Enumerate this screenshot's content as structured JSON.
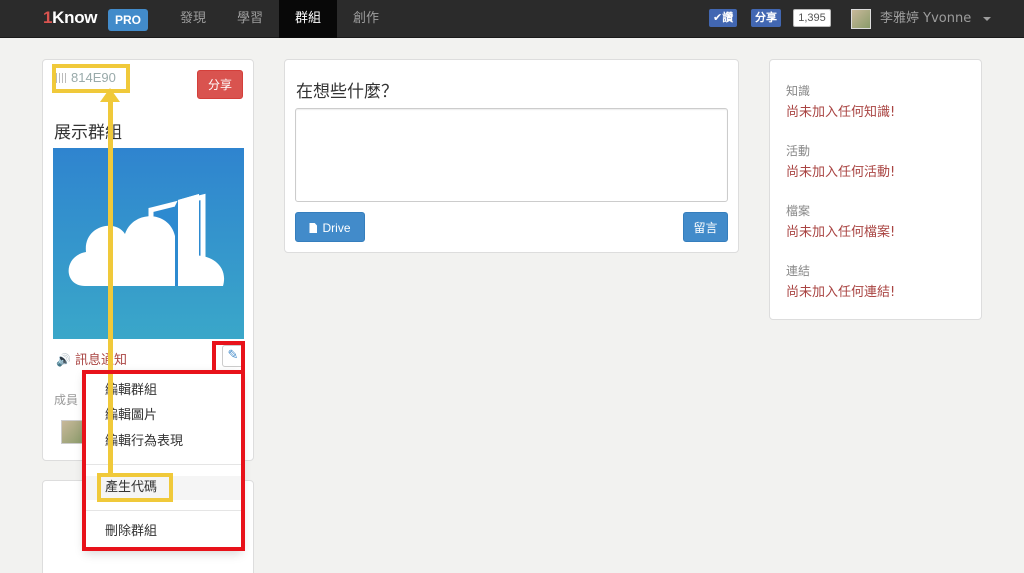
{
  "navbar": {
    "brand_one": "1",
    "brand_text": "Know",
    "pro_badge": "PRO",
    "items": [
      {
        "label": "發現",
        "active": false
      },
      {
        "label": "學習",
        "active": false
      },
      {
        "label": "群組",
        "active": true
      },
      {
        "label": "創作",
        "active": false
      }
    ],
    "fb_like": "✔讚",
    "fb_share": "分享",
    "fb_count": "1,395",
    "user_name": "李雅婷 Yvonne"
  },
  "group": {
    "code": "814E90",
    "share_label": "分享",
    "title": "展示群組",
    "notify_label": "訊息通知",
    "members_label": "成員"
  },
  "dropdown": {
    "items": [
      "編輯群組",
      "編輯圖片",
      "編輯行為表現",
      "產生代碼",
      "刪除群組"
    ]
  },
  "post": {
    "prompt": "在想些什麼？",
    "textarea_value": "",
    "drive_label": "Drive",
    "comment_label": "留言"
  },
  "info": {
    "sections": [
      {
        "label": "知識",
        "value": "尚未加入任何知識!"
      },
      {
        "label": "活動",
        "value": "尚未加入任何活動!"
      },
      {
        "label": "檔案",
        "value": "尚未加入任何檔案!"
      },
      {
        "label": "連結",
        "value": "尚未加入任何連結!"
      }
    ]
  },
  "colors": {
    "navbar_bg": "#2b2b2b",
    "accent_blue": "#428bca",
    "danger_red": "#d9534f",
    "annotation_red": "#e8121a",
    "annotation_yellow": "#f0c93a"
  }
}
